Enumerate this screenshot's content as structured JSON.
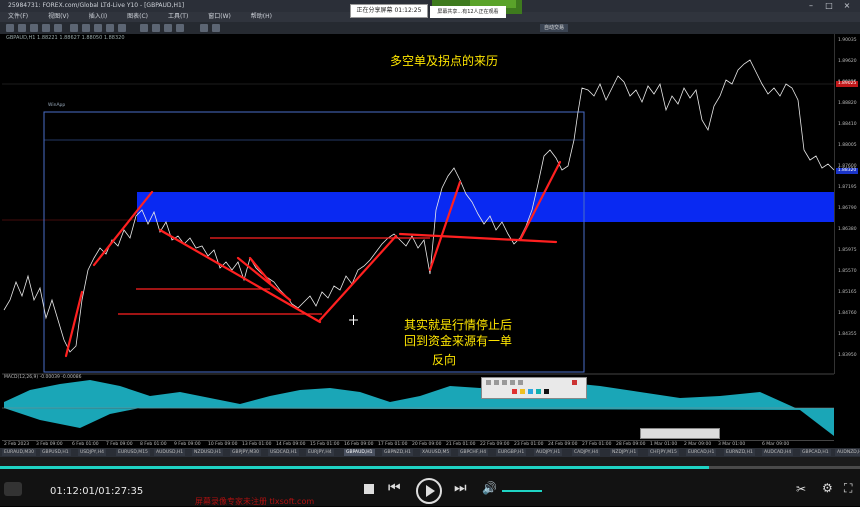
{
  "window": {
    "title": "25984731: FOREX.com/Global LTd-Live Y10 - [GBPAUD,H1]",
    "menu": [
      "文件(F)",
      "视图(V)",
      "插入(I)",
      "图表(C)",
      "工具(T)",
      "窗口(W)",
      "帮助(H)"
    ],
    "autotrade_label": "自动交易"
  },
  "overlay": {
    "timer_label": "正在分享屏幕",
    "timer_value": "01:12:25",
    "note_text": "屏幕共享...有12人正在观看"
  },
  "chart": {
    "symbol_info": "GBPAUD,H1  1.88221 1.88627 1.88050 1.88320",
    "box_label": "WinApp",
    "annotation_title": "多空单及拐点的来历",
    "annotation_body_line1": "其实就是行情停止后",
    "annotation_body_line2": "回到资金来源有一单",
    "annotation_body_line3": "反向",
    "indicator_label": "MACD(12,26,9)  -0.00039  -0.00086",
    "price_labels": [
      "1.90035",
      "1.89620",
      "1.89225",
      "1.88820",
      "1.88410",
      "1.88005",
      "1.87600",
      "1.87195",
      "1.86790",
      "1.86380",
      "1.85975",
      "1.85570",
      "1.85165",
      "1.84760",
      "1.84355",
      "1.83950"
    ],
    "price_tag_red": "1.89025",
    "price_tag_blue": "1.88320",
    "time_labels": [
      "2 Feb 2023",
      "3 Feb 09:00",
      "6 Feb 01:00",
      "7 Feb 09:00",
      "8 Feb 01:00",
      "9 Feb 09:00",
      "10 Feb 09:00",
      "13 Feb 01:00",
      "14 Feb 09:00",
      "15 Feb 01:00",
      "16 Feb 09:00",
      "17 Feb 01:00",
      "20 Feb 09:00",
      "21 Feb 01:00",
      "22 Feb 09:00",
      "23 Feb 01:00",
      "24 Feb 09:00",
      "27 Feb 01:00",
      "28 Feb 09:00",
      "1 Mar 01:00",
      "2 Mar 09:00",
      "3 Mar 01:00",
      "6 Mar 09:00"
    ]
  },
  "tabs": [
    "EURAUD,M30",
    "GBPUSD,H1",
    "USDJPY,H4",
    "EURUSD,M15",
    "AUDUSD,H1",
    "NZDUSD,H1",
    "GBPJPY,M30",
    "USDCAD,H1",
    "EURJPY,H4",
    "GBPAUD,H1",
    "GBPNZD,H1",
    "XAUUSD,M5",
    "GBPCHF,H4",
    "EURGBP,H1",
    "AUDJPY,H1",
    "CADJPY,H4",
    "NZDJPY,H1",
    "CHFJPY,M15",
    "EURCAD,H1",
    "EURNZD,H1",
    "AUDCAD,H4",
    "GBPCAD,H1",
    "AUDNZD,H4"
  ],
  "active_tab_index": 9,
  "player": {
    "time_display": "01:12:01/01:27:35",
    "progress": 0.824,
    "volume": 0.7,
    "watermark": "屏幕录像专家未注册 tlxsoft.com"
  }
}
